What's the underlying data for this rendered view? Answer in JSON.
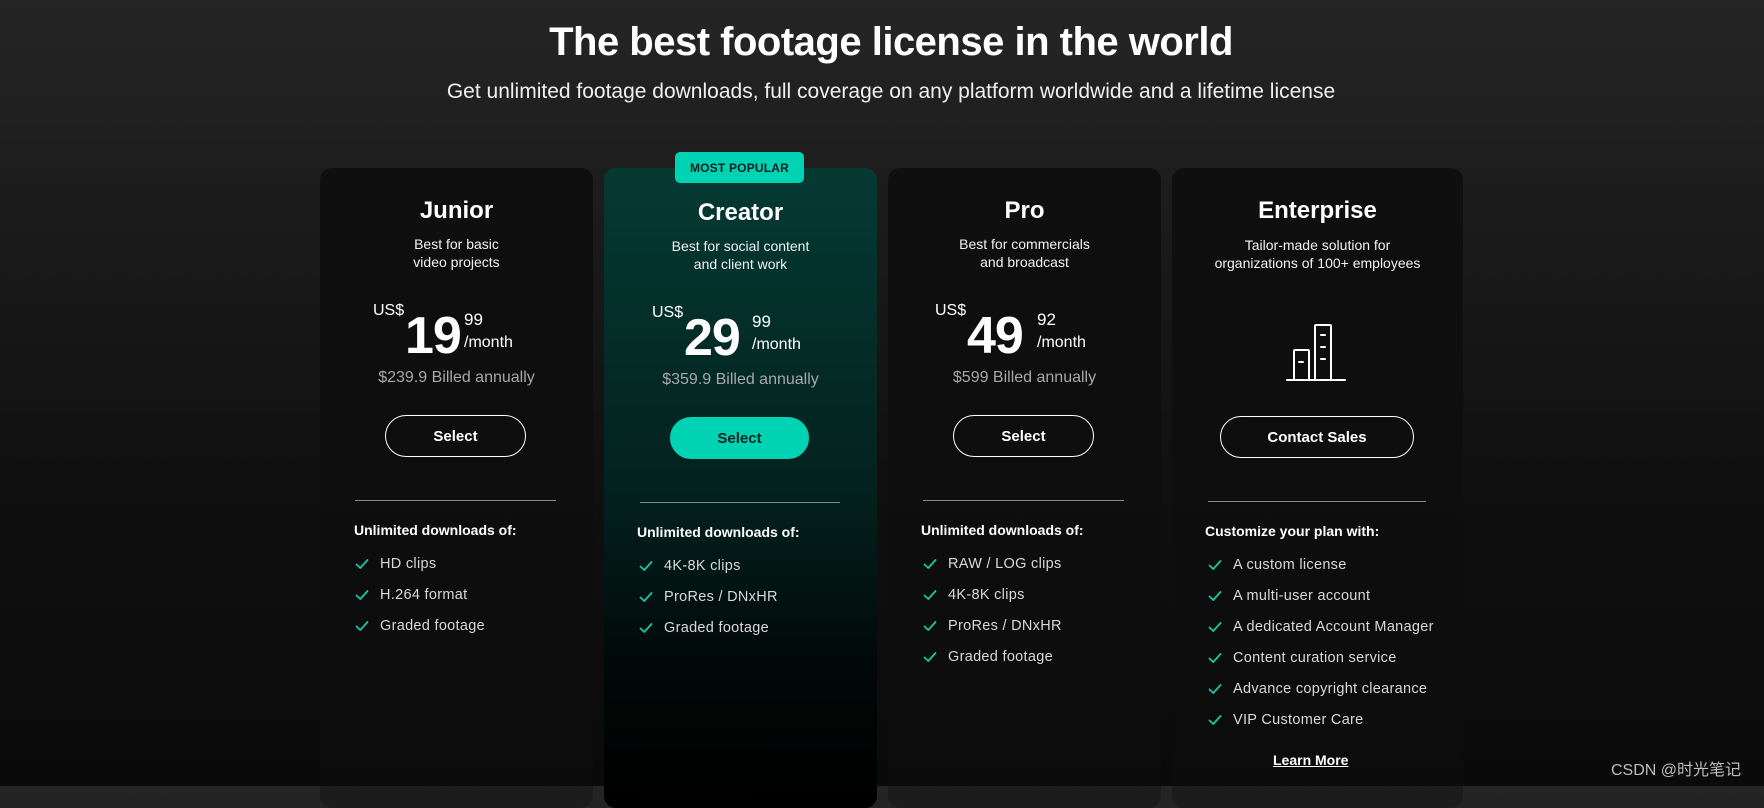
{
  "header": {
    "title": "The best footage license in the world",
    "subtitle": "Get unlimited footage downloads, full coverage on any platform worldwide and a lifetime license"
  },
  "plans": [
    {
      "name": "Junior",
      "desc_line1": "Best for basic",
      "desc_line2": "video projects",
      "currency": "US$",
      "price_whole": "19",
      "price_cents": "99",
      "per": "/month",
      "billed": "$239.9 Billed annually",
      "button_label": "Select",
      "features_heading": "Unlimited downloads of:",
      "features": [
        "HD clips",
        "H.264 format",
        "Graded footage"
      ]
    },
    {
      "name": "Creator",
      "badge": "MOST POPULAR",
      "desc_line1": "Best for social content",
      "desc_line2": "and client work",
      "currency": "US$",
      "price_whole": "29",
      "price_cents": "99",
      "per": "/month",
      "billed": "$359.9 Billed annually",
      "button_label": "Select",
      "features_heading": "Unlimited downloads of:",
      "features": [
        "4K-8K clips",
        "ProRes / DNxHR",
        "Graded footage"
      ]
    },
    {
      "name": "Pro",
      "desc_line1": "Best for commercials",
      "desc_line2": "and broadcast",
      "currency": "US$",
      "price_whole": "49",
      "price_cents": "92",
      "per": "/month",
      "billed": "$599 Billed annually",
      "button_label": "Select",
      "features_heading": "Unlimited downloads of:",
      "features": [
        "RAW / LOG clips",
        "4K-8K clips",
        "ProRes / DNxHR",
        "Graded footage"
      ]
    },
    {
      "name": "Enterprise",
      "desc_line1": "Tailor-made solution for",
      "desc_line2": "organizations of 100+ employees",
      "icon": "building-icon",
      "button_label": "Contact Sales",
      "features_heading": "Customize your plan with:",
      "features": [
        "A custom license",
        "A multi-user account",
        "A dedicated Account Manager",
        "Content curation service",
        "Advance copyright clearance",
        "VIP Customer Care"
      ],
      "learn_more": "Learn More"
    }
  ],
  "watermark": "CSDN @时光笔记",
  "colors": {
    "accent": "#00d2b4",
    "check": "#18c7a8",
    "featured_card": "#053a33",
    "background": "#1b1b1b"
  }
}
